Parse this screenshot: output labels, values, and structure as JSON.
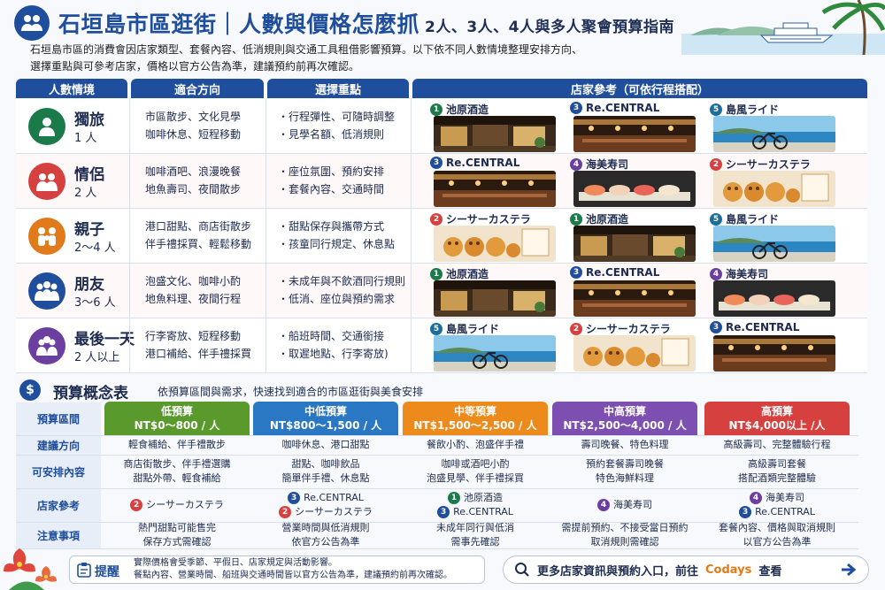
{
  "header": {
    "title": "石垣島市區逛街｜人數與價格怎麼抓",
    "subtitle": "2人、3人、4人與多人聚會預算指南",
    "intro_line1": "石垣島市區的消費會因店家類型、套餐內容、低消規則與交通工具租借影響預算。以下依不同人數情境整理安排方向、",
    "intro_line2": "選擇重點與可參考店家，價格以官方公告為準，建議預約前再次確認。"
  },
  "table_headers": [
    "人數情境",
    "適合方向",
    "選擇重點",
    "店家參考（可依行程搭配）"
  ],
  "rows": [
    {
      "name": "獨旅",
      "count": "1 人",
      "color": "#1b7a4a",
      "dir1": "市區散步、文化見學",
      "dir2": "咖啡休息、短程移動",
      "key1": "・行程彈性、可隨時調整",
      "key2": "・見學名額、低消規則",
      "shops": [
        {
          "num": "1",
          "name": "池原酒造",
          "kind": "brewery"
        },
        {
          "num": "3",
          "name": "Re.CENTRAL",
          "kind": "bar"
        },
        {
          "num": "5",
          "name": "島風ライド",
          "kind": "bike"
        }
      ]
    },
    {
      "name": "情侶",
      "count": "2 人",
      "color": "#d6403f",
      "dir1": "咖啡酒吧、浪漫晚餐",
      "dir2": "地魚壽司、夜間散步",
      "key1": "・座位氛圍、預約安排",
      "key2": "・套餐內容、交通時間",
      "shops": [
        {
          "num": "3",
          "name": "Re.CENTRAL",
          "kind": "bar"
        },
        {
          "num": "4",
          "name": "海美寿司",
          "kind": "sushi"
        },
        {
          "num": "2",
          "name": "シーサーカステラ",
          "kind": "cake"
        }
      ]
    },
    {
      "name": "親子",
      "count": "2～4 人",
      "color": "#e07a1a",
      "dir1": "港口甜點、商店街散步",
      "dir2": "伴手禮採買、輕鬆移動",
      "key1": "・甜點保存與攜帶方式",
      "key2": "・孩童同行規定、休息點",
      "shops": [
        {
          "num": "2",
          "name": "シーサーカステラ",
          "kind": "cake"
        },
        {
          "num": "1",
          "name": "池原酒造",
          "kind": "brewery"
        },
        {
          "num": "5",
          "name": "島風ライド",
          "kind": "bike"
        }
      ]
    },
    {
      "name": "朋友",
      "count": "3～6 人",
      "color": "#1f4e9c",
      "dir1": "泡盛文化、咖啡小酌",
      "dir2": "地魚料理、夜間行程",
      "key1": "・未成年與不飲酒同行規則",
      "key2": "・低消、座位與預約需求",
      "shops": [
        {
          "num": "1",
          "name": "池原酒造",
          "kind": "brewery"
        },
        {
          "num": "3",
          "name": "Re.CENTRAL",
          "kind": "bar"
        },
        {
          "num": "4",
          "name": "海美寿司",
          "kind": "sushi"
        }
      ]
    },
    {
      "name": "最後一天",
      "count": "2 人以上",
      "color": "#6b3fa0",
      "dir1": "行李寄放、短程移動",
      "dir2": "港口補給、伴手禮採買",
      "key1": "・船班時間、交通銜接",
      "key2": "・取遲地點、行李寄放)",
      "shops": [
        {
          "num": "5",
          "name": "島風ライド",
          "kind": "bike"
        },
        {
          "num": "2",
          "name": "シーサーカステラ",
          "kind": "cake"
        },
        {
          "num": "3",
          "name": "Re.CENTRAL",
          "kind": "bar"
        }
      ]
    }
  ],
  "budget": {
    "title": "預算概念表",
    "desc": "依預算區間與需求，快速找到適合的市區逛街與美食安排",
    "row_labels": [
      "預算區間",
      "建議方向",
      "可安排內容",
      "店家參考",
      "注意事項"
    ],
    "columns": [
      {
        "name": "低預算",
        "range": "NT$0～800 / 人",
        "color": "#5a9a2c",
        "direction": "輕食補給、伴手禮散步",
        "content1": "商店街散步、伴手禮選購",
        "content2": "甜點外帶、輕食補給",
        "shops": [
          {
            "num": "2",
            "name": "シーサーカステラ"
          }
        ],
        "note1": "熱門甜點可能售完",
        "note2": "保存方式需確認"
      },
      {
        "name": "中低預算",
        "range": "NT$800～1,500 / 人",
        "color": "#2a78c4",
        "direction": "咖啡休息、港口甜點",
        "content1": "甜點、咖啡飲品",
        "content2": "簡單伴手禮、休息點",
        "shops": [
          {
            "num": "3",
            "name": "Re.CENTRAL"
          },
          {
            "num": "2",
            "name": "シーサーカステラ"
          }
        ],
        "note1": "營業時間與低消規則",
        "note2": "依官方公告為準"
      },
      {
        "name": "中等預算",
        "range": "NT$1,500～2,500 / 人",
        "color": "#ec8a1c",
        "direction": "餐飲小酌、泡盛伴手禮",
        "content1": "咖啡或酒吧小酌",
        "content2": "泡盛見學、伴手禮採買",
        "shops": [
          {
            "num": "1",
            "name": "池原酒造"
          },
          {
            "num": "3",
            "name": "Re.CENTRAL"
          }
        ],
        "note1": "未成年同行與低消",
        "note2": "需事先確認"
      },
      {
        "name": "中高預算",
        "range": "NT$2,500～4,000 / 人",
        "color": "#7c4fb0",
        "direction": "壽司晚餐、特色料理",
        "content1": "預約套餐壽司晚餐",
        "content2": "特色海鮮料理",
        "shops": [
          {
            "num": "4",
            "name": "海美寿司"
          }
        ],
        "note1": "需提前預約、不接受當日預約",
        "note2": "取消規則需確認"
      },
      {
        "name": "高預算",
        "range": "NT$4,000以上 /人",
        "color": "#d6403f",
        "direction": "高級壽司、完整體驗行程",
        "content1": "高級壽司套餐",
        "content2": "搭配酒類完整體驗",
        "shops": [
          {
            "num": "4",
            "name": "海美寿司"
          },
          {
            "num": "3",
            "name": "Re.CENTRAL"
          }
        ],
        "note1": "套餐內容、價格與取消規則",
        "note2": "以官方公告為準"
      }
    ]
  },
  "footer": {
    "tip_label": "提醒",
    "tip_line1": "實際價格會受季節、平假日、店家規定與活動影響。",
    "tip_line2": "餐點內容、營業時間、船班與交通時間皆以官方公告為準，建議預約前再次確認。",
    "more_text": "更多店家資訊與預約入口，前往",
    "more_brand": "Codays",
    "more_suffix": "查看"
  },
  "icons": [
    "people-icon",
    "person-icon",
    "couple-icon",
    "family-icon",
    "friends-icon",
    "group-icon",
    "dollar-icon",
    "clipboard-icon",
    "search-icon",
    "arrow-right-icon"
  ]
}
